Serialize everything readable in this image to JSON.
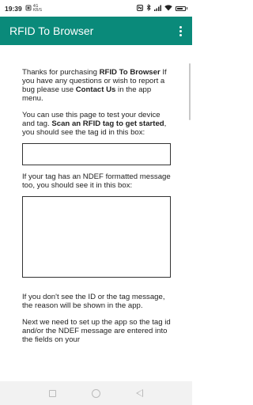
{
  "status_bar": {
    "time": "19:39",
    "network_label_top": "4G",
    "network_label_bottom": "KB/S",
    "battery_level_percent": 85
  },
  "app_bar": {
    "title": "RFID To Browser",
    "menu_icon": "more-vertical-icon"
  },
  "content": {
    "intro": {
      "t1": "Thanks for purchasing ",
      "b1": "RFID To Browser",
      "t2": " If you have any questions or wish to report a bug please use ",
      "b2": "Contact Us",
      "t3": " in the app menu."
    },
    "test": {
      "t1": "You can use this page to test your device and tag. ",
      "b1": "Scan an RFID tag to get started",
      "t2": ", you should see the tag id in this box:"
    },
    "tag_id_value": "",
    "ndef_intro": "If your tag has an NDEF formatted message too, you should see it in this box:",
    "ndef_message_value": "",
    "reason": "If you don't see the ID or the tag message, the reason will be shown in the app.",
    "next": "Next we need to set up the app so the tag id and/or the NDEF message are entered into the fields on your"
  },
  "nav_bar": {
    "recents_icon": "square-icon",
    "home_icon": "circle-icon",
    "back_icon": "triangle-back-icon"
  }
}
